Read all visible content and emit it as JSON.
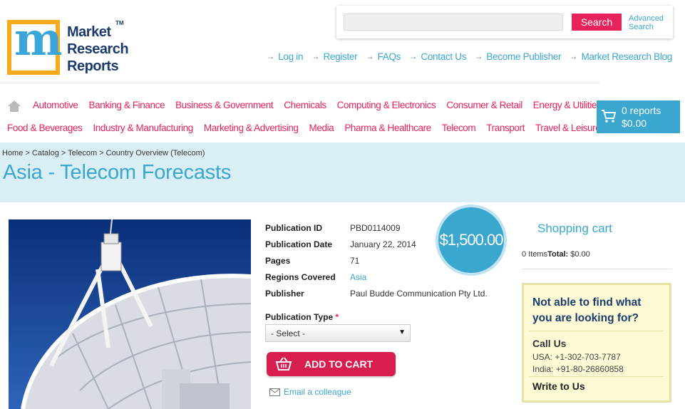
{
  "logo": {
    "line1": "Market",
    "line2": "Research",
    "line3": "Reports",
    "tm": "TM",
    "letter": "m"
  },
  "search": {
    "placeholder": "",
    "button_label": "Search",
    "advanced_line1": "Advanced",
    "advanced_line2": "Search"
  },
  "top_links": [
    "Log in",
    "Register",
    "FAQs",
    "Contact Us",
    "Become Publisher",
    "Market Research Blog"
  ],
  "categories_row1": [
    "Automotive",
    "Banking & Finance",
    "Business & Government",
    "Chemicals",
    "Computing & Electronics",
    "Consumer & Retail",
    "Energy & Utilities"
  ],
  "categories_row2": [
    "Food & Beverages",
    "Industry & Manufacturing",
    "Marketing & Advertising",
    "Media",
    "Pharma & Healthcare",
    "Telecom",
    "Transport",
    "Travel & Leisure"
  ],
  "cart": {
    "reports": "0 reports",
    "total": "$0.00"
  },
  "breadcrumb": {
    "home": "Home",
    "catalog": "Catalog",
    "telecom": "Telecom",
    "current": "Country Overview (Telecom)",
    "sep": " > "
  },
  "page_title": "Asia - Telecom Forecasts",
  "details": {
    "pub_id_label": "Publication ID",
    "pub_id": "PBD0114009",
    "pub_date_label": "Publication Date",
    "pub_date": "January 22, 2014",
    "pages_label": "Pages",
    "pages": "71",
    "regions_label": "Regions Covered",
    "regions": "Asia",
    "publisher_label": "Publisher",
    "publisher": "Paul Budde Communication Pty Ltd."
  },
  "price": "$1,500.00",
  "pub_type": {
    "label": "Publication Type",
    "required": "*",
    "selected": "- Select -"
  },
  "add_to_cart": "ADD TO CART",
  "email_colleague": "Email a colleague",
  "shopping_cart": {
    "title": "Shopping cart",
    "items": "0 Items",
    "total_label": "Total:",
    "total": "$0.00"
  },
  "help": {
    "title_line1": "Not able to find what",
    "title_line2": "you are looking for?",
    "call_us": "Call Us",
    "usa": "USA: +1-302-703-7787",
    "india": "India: +91-80-26860858",
    "write_to_us": "Write to Us"
  },
  "colors": {
    "accent_blue": "#3aa7cf",
    "accent_pink": "#e8225a",
    "navy": "#1d3a6e",
    "logo_orange": "#f7a81b"
  }
}
